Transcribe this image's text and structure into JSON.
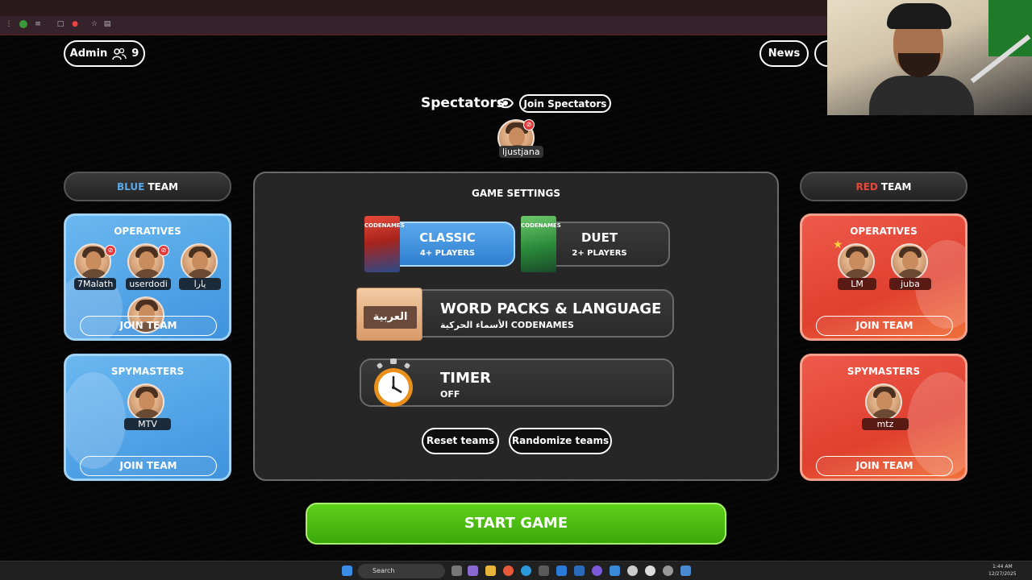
{
  "header": {
    "admin_label": "Admin",
    "player_count": "9",
    "news_label": "News"
  },
  "spectators": {
    "title": "Spectators",
    "join_label": "Join Spectators",
    "members": [
      "ljustjana"
    ]
  },
  "blue_team": {
    "header_color_word": "BLUE",
    "header_word": "TEAM",
    "operatives": {
      "title": "OPERATIVES",
      "members": [
        "7Malath",
        "userdodi",
        "يارا"
      ],
      "join_label": "JOIN TEAM"
    },
    "spymasters": {
      "title": "SPYMASTERS",
      "members": [
        "MTV"
      ],
      "join_label": "JOIN TEAM"
    }
  },
  "red_team": {
    "header_color_word": "RED",
    "header_word": "TEAM",
    "operatives": {
      "title": "OPERATIVES",
      "members": [
        "LM",
        "juba"
      ],
      "join_label": "JOIN TEAM"
    },
    "spymasters": {
      "title": "SPYMASTERS",
      "members": [
        "mtz"
      ],
      "join_label": "JOIN TEAM"
    }
  },
  "settings": {
    "title": "GAME SETTINGS",
    "modes": [
      {
        "title": "CLASSIC",
        "sub": "4+ PLAYERS",
        "box_label": "CODENAMES",
        "selected": true
      },
      {
        "title": "DUET",
        "sub": "2+ PLAYERS",
        "box_label": "CODENAMES",
        "selected": false
      }
    ],
    "word_packs": {
      "title": "WORD PACKS & LANGUAGE",
      "sub": "الأسماء الحركية CODENAMES",
      "card_text": "العربية"
    },
    "timer": {
      "title": "TIMER",
      "sub": "OFF"
    },
    "reset_label": "Reset teams",
    "randomize_label": "Randomize teams"
  },
  "start_label": "START GAME",
  "taskbar": {
    "search_placeholder": "Search",
    "time": "1:44 AM",
    "date": "12/27/2025"
  },
  "colors": {
    "blue_accent": "#5aa8e8",
    "red_accent": "#e8473a",
    "start_green": "#4cbd12"
  }
}
